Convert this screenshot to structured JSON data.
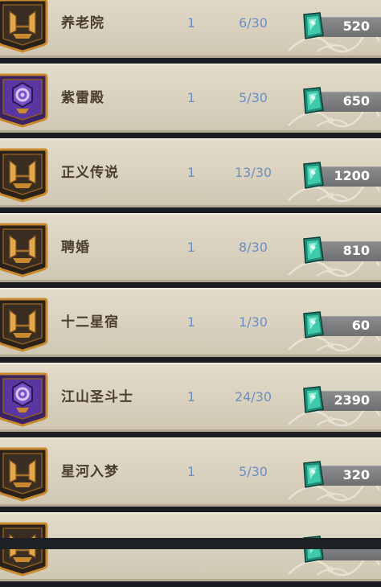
{
  "rows": [
    {
      "name": "养老院",
      "level": "1",
      "count": "6/30",
      "price": "520",
      "emblem": "gold-crown-emblem-icon"
    },
    {
      "name": "紫雷殿",
      "level": "1",
      "count": "5/30",
      "price": "650",
      "emblem": "purple-gear-emblem-icon"
    },
    {
      "name": "正义传说",
      "level": "1",
      "count": "13/30",
      "price": "1200",
      "emblem": "gold-crown-emblem-icon"
    },
    {
      "name": "聘婚",
      "level": "1",
      "count": "8/30",
      "price": "810",
      "emblem": "gold-crown-emblem-icon"
    },
    {
      "name": "十二星宿",
      "level": "1",
      "count": "1/30",
      "price": "60",
      "emblem": "gold-crown-emblem-icon"
    },
    {
      "name": "江山圣斗士",
      "level": "1",
      "count": "24/30",
      "price": "2390",
      "emblem": "purple-gear-emblem-icon"
    },
    {
      "name": "星河入梦",
      "level": "1",
      "count": "5/30",
      "price": "320",
      "emblem": "gold-crown-emblem-icon"
    },
    {
      "name": "",
      "level": "",
      "count": "",
      "price": "",
      "emblem": "gold-crown-emblem-icon"
    }
  ],
  "colors": {
    "row_bg": "#ddd5c3",
    "name_text": "#4a3e2e",
    "stat_text": "#6a8fc0",
    "gem": "#2fb79a",
    "emblem_gold": "#c9892f",
    "emblem_purple": "#6a3fb0"
  }
}
